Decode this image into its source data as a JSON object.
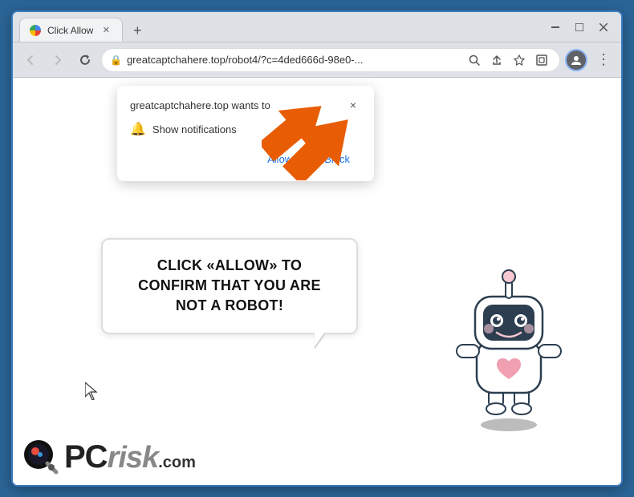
{
  "browser": {
    "tab": {
      "title": "Click Allow",
      "favicon": "globe"
    },
    "new_tab_btn": "+",
    "window_controls": {
      "minimize": "—",
      "maximize": "☐",
      "close": "✕"
    },
    "nav": {
      "back": "←",
      "forward": "→",
      "refresh": "↻"
    },
    "url": {
      "text": "greatcaptchahere.top/robot4/?c=4ded666d-98e0-...",
      "secure": "🔒"
    },
    "url_actions": {
      "search": "🔍",
      "share": "⎋",
      "bookmark": "☆",
      "extensions": "⬜",
      "profile": "👤",
      "menu": "⋮"
    }
  },
  "notification_popup": {
    "site_text": "greatcaptchahere.top wants to",
    "show_notifications": "Show notifications",
    "allow_btn": "Allow",
    "block_btn": "Block",
    "close_btn": "×"
  },
  "speech_bubble": {
    "text": "CLICK «ALLOW» TO CONFIRM THAT YOU ARE NOT A ROBOT!"
  },
  "pcrisk": {
    "pc_text": "PC",
    "risk_text": "risk",
    "dot_com": ".com"
  }
}
